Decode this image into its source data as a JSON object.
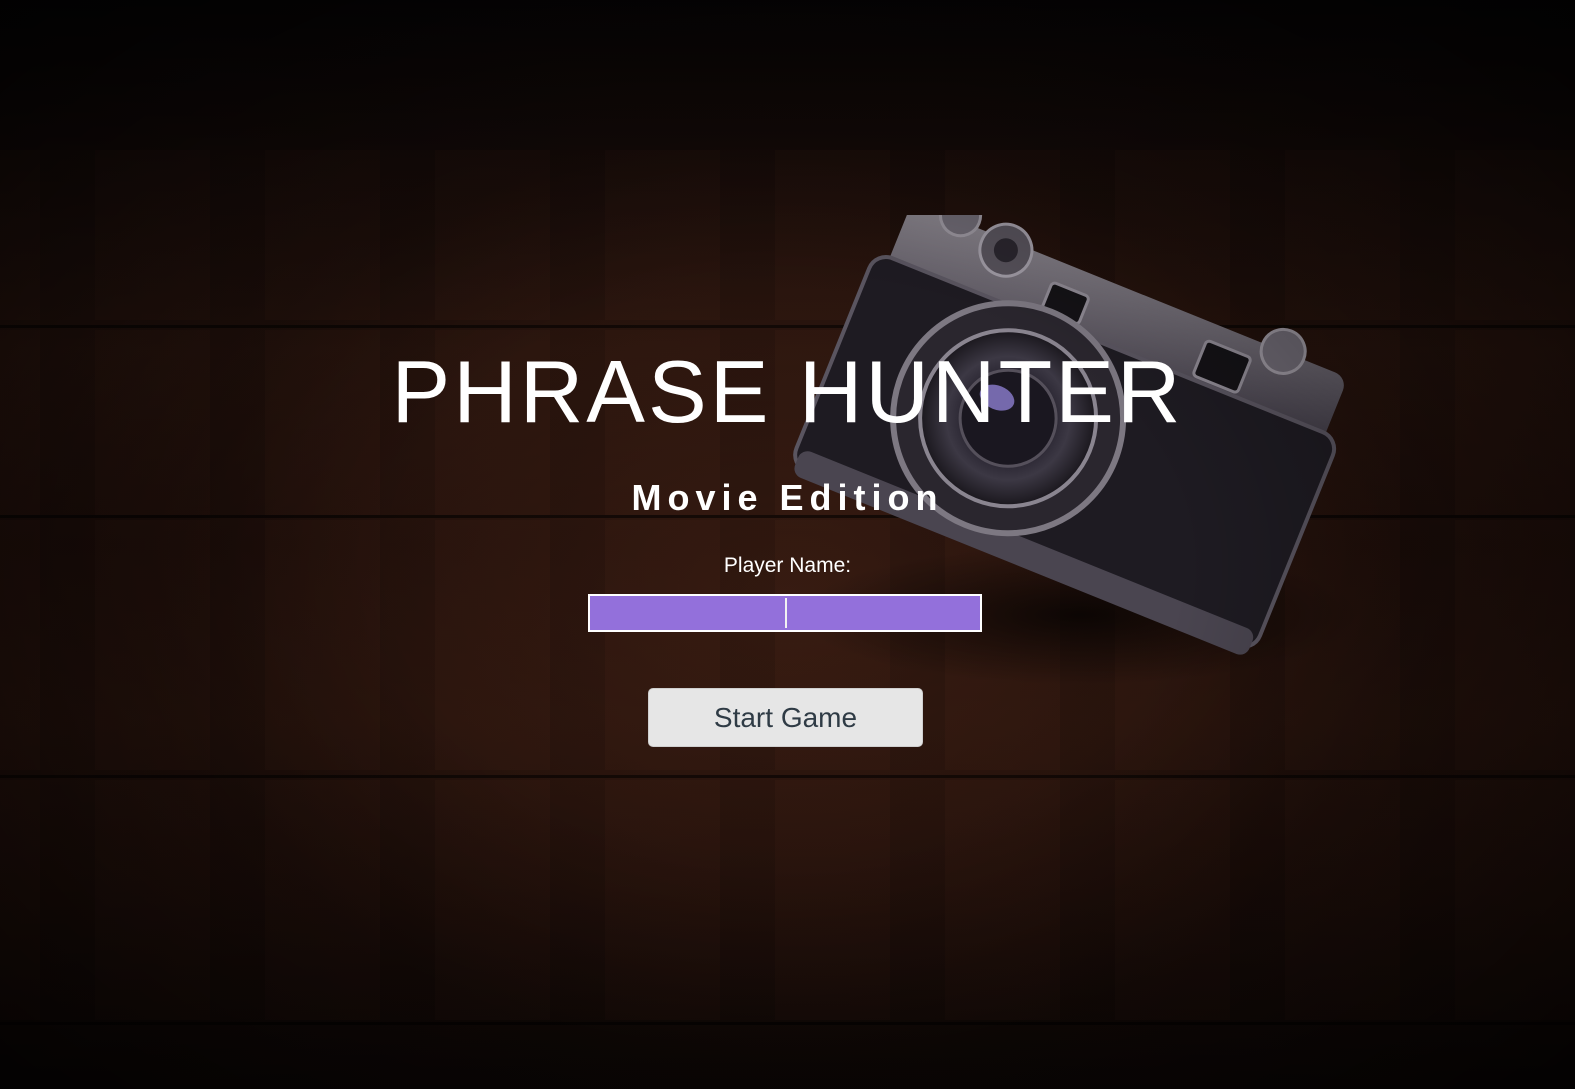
{
  "game": {
    "title": "PHRASE HUNTER",
    "subtitle": "Movie Edition"
  },
  "form": {
    "player_name_label": "Player Name:",
    "player_name_value": "",
    "start_button_label": "Start Game"
  },
  "colors": {
    "input_background": "#9370db",
    "button_background": "#e6e6e6",
    "title_text": "#ffffff"
  },
  "background": {
    "icon": "camera-photo"
  }
}
